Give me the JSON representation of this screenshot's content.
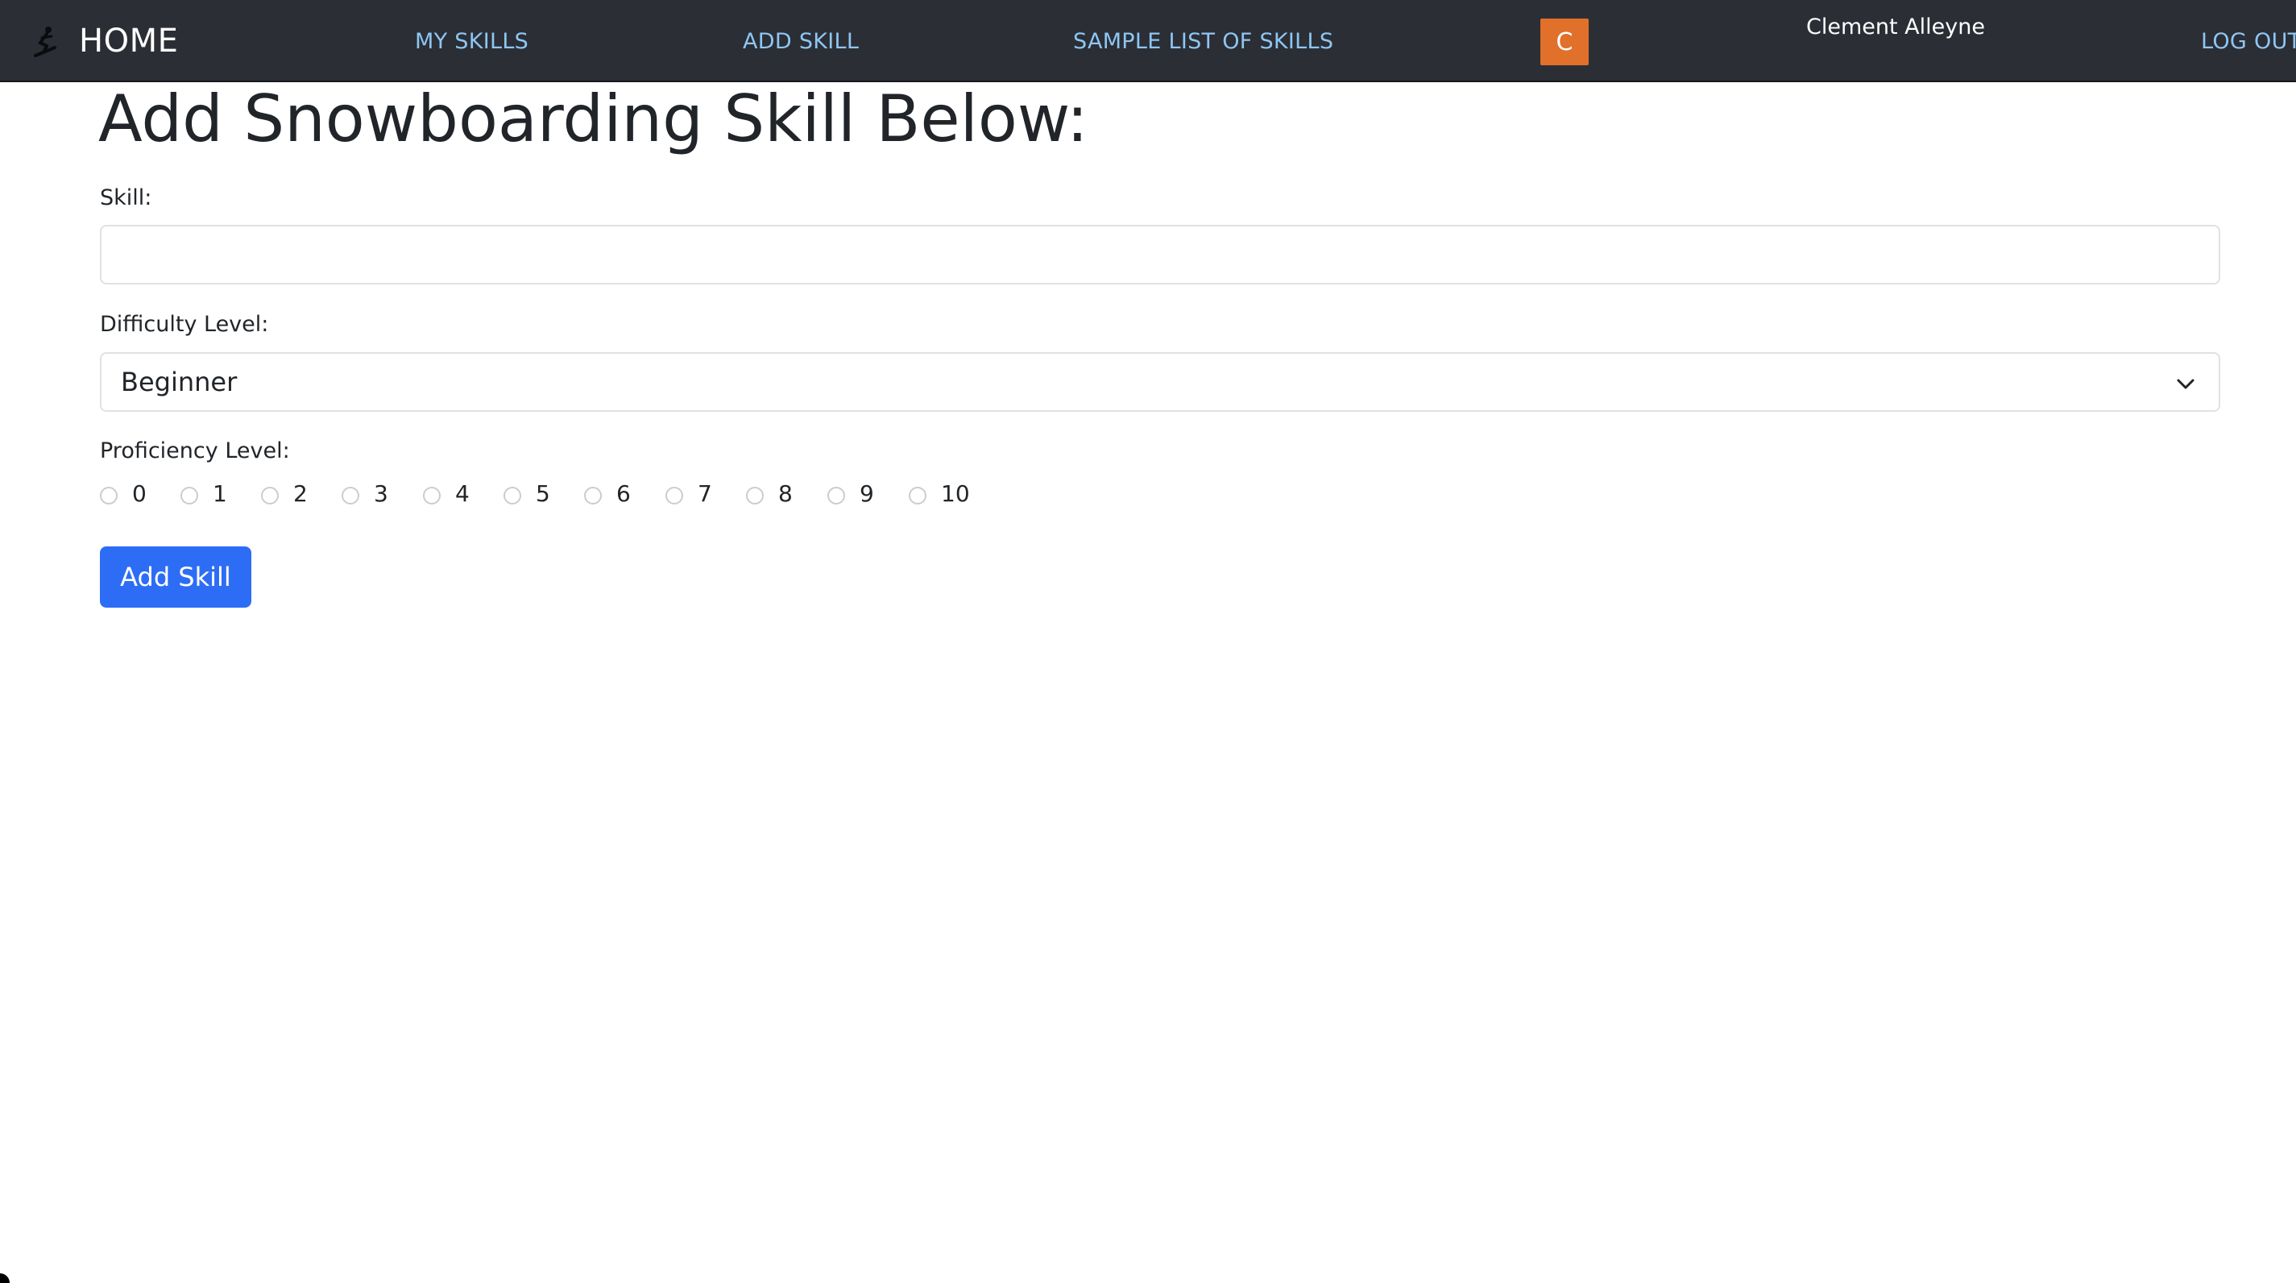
{
  "navbar": {
    "brand_label": "HOME",
    "brand_icon": "snowboarder-icon",
    "links": {
      "my_skills": "MY SKILLS",
      "add_skill": "ADD SKILL",
      "sample_list": "SAMPLE LIST OF SKILLS",
      "log_out": "LOG OUT"
    },
    "avatar_initial": "C",
    "user_name": "Clement Alleyne"
  },
  "form": {
    "title": "Add Snowboarding Skill Below:",
    "skill_label": "Skill:",
    "skill_value": "",
    "difficulty_label": "Difficulty Level:",
    "difficulty_selected": "Beginner",
    "proficiency_label": "Proficiency Level:",
    "proficiency_options": [
      "0",
      "1",
      "2",
      "3",
      "4",
      "5",
      "6",
      "7",
      "8",
      "9",
      "10"
    ],
    "submit_label": "Add Skill"
  },
  "colors": {
    "navbar_bg": "#2b2e35",
    "nav_link": "#8ec6f2",
    "avatar_bg": "#e0702a",
    "primary_button": "#2d6df6"
  }
}
